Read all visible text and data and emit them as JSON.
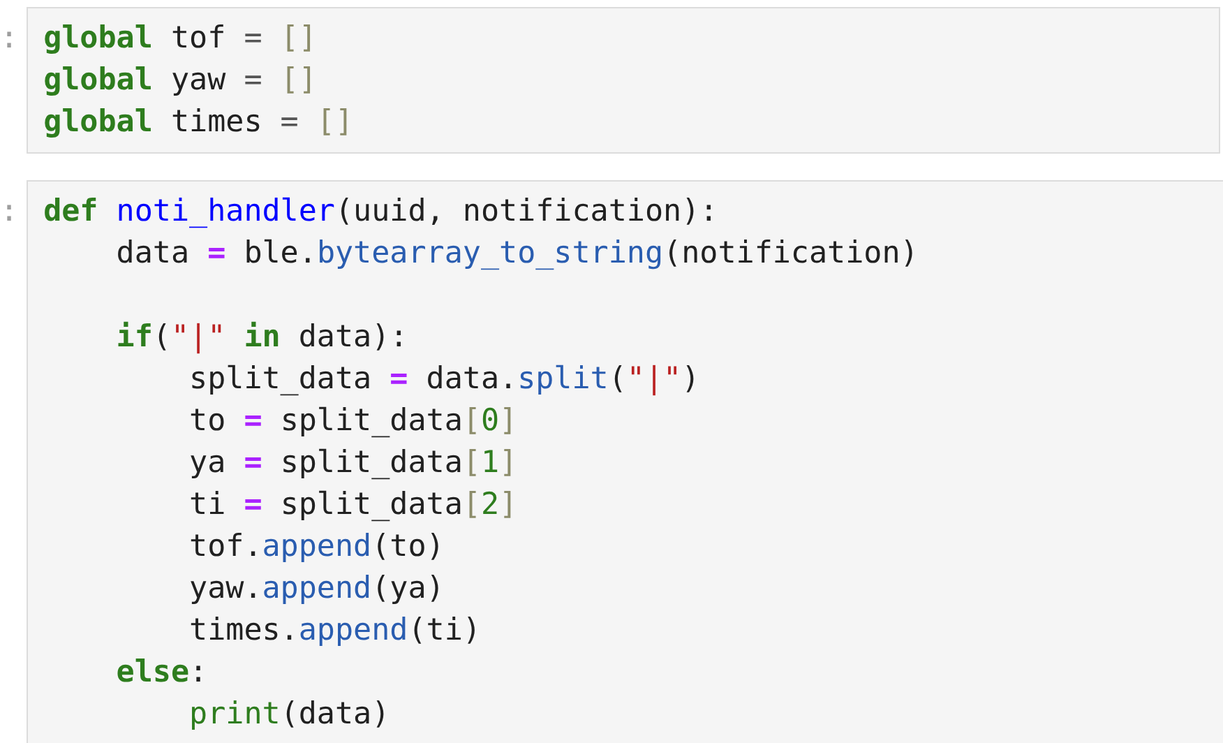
{
  "cells": [
    {
      "prompt": ":",
      "lines": [
        {
          "kind": "code",
          "tokens": [
            {
              "text": "global",
              "kind": "keyword"
            },
            {
              "text": " tof",
              "kind": "name"
            },
            {
              "text": " = ",
              "kind": "plain_op"
            },
            {
              "text": "[]",
              "kind": "bracket"
            }
          ]
        },
        {
          "kind": "code",
          "tokens": [
            {
              "text": "global",
              "kind": "keyword"
            },
            {
              "text": " yaw",
              "kind": "name"
            },
            {
              "text": " = ",
              "kind": "plain_op"
            },
            {
              "text": "[]",
              "kind": "bracket"
            }
          ]
        },
        {
          "kind": "code",
          "tokens": [
            {
              "text": "global",
              "kind": "keyword"
            },
            {
              "text": " times",
              "kind": "name"
            },
            {
              "text": " = ",
              "kind": "plain_op"
            },
            {
              "text": "[]",
              "kind": "bracket"
            }
          ]
        }
      ]
    },
    {
      "prompt": ":",
      "lines": [
        {
          "kind": "code",
          "tokens": [
            {
              "text": "def",
              "kind": "keyword"
            },
            {
              "text": " noti_handler",
              "kind": "function"
            },
            {
              "text": "(uuid, notification):",
              "kind": "name"
            }
          ]
        },
        {
          "kind": "code",
          "tokens": [
            {
              "text": "    data ",
              "kind": "name"
            },
            {
              "text": "=",
              "kind": "operator"
            },
            {
              "text": " ble.",
              "kind": "name"
            },
            {
              "text": "bytearray_to_string",
              "kind": "method"
            },
            {
              "text": "(notification)",
              "kind": "name"
            }
          ]
        },
        {
          "kind": "blank"
        },
        {
          "kind": "code",
          "tokens": [
            {
              "text": "    if",
              "kind": "keyword"
            },
            {
              "text": "(",
              "kind": "name"
            },
            {
              "text": "\"|\"",
              "kind": "string"
            },
            {
              "text": " in",
              "kind": "keyword"
            },
            {
              "text": " data):",
              "kind": "name"
            }
          ]
        },
        {
          "kind": "code",
          "tokens": [
            {
              "text": "        split_data ",
              "kind": "name"
            },
            {
              "text": "=",
              "kind": "operator"
            },
            {
              "text": " data.",
              "kind": "name"
            },
            {
              "text": "split",
              "kind": "method"
            },
            {
              "text": "(",
              "kind": "name"
            },
            {
              "text": "\"|\"",
              "kind": "string"
            },
            {
              "text": ")",
              "kind": "name"
            }
          ]
        },
        {
          "kind": "code",
          "tokens": [
            {
              "text": "        to ",
              "kind": "name"
            },
            {
              "text": "=",
              "kind": "operator"
            },
            {
              "text": " split_data",
              "kind": "name"
            },
            {
              "text": "[",
              "kind": "bracket"
            },
            {
              "text": "0",
              "kind": "number"
            },
            {
              "text": "]",
              "kind": "bracket"
            }
          ]
        },
        {
          "kind": "code",
          "tokens": [
            {
              "text": "        ya ",
              "kind": "name"
            },
            {
              "text": "=",
              "kind": "operator"
            },
            {
              "text": " split_data",
              "kind": "name"
            },
            {
              "text": "[",
              "kind": "bracket"
            },
            {
              "text": "1",
              "kind": "number"
            },
            {
              "text": "]",
              "kind": "bracket"
            }
          ]
        },
        {
          "kind": "code",
          "tokens": [
            {
              "text": "        ti ",
              "kind": "name"
            },
            {
              "text": "=",
              "kind": "operator"
            },
            {
              "text": " split_data",
              "kind": "name"
            },
            {
              "text": "[",
              "kind": "bracket"
            },
            {
              "text": "2",
              "kind": "number"
            },
            {
              "text": "]",
              "kind": "bracket"
            }
          ]
        },
        {
          "kind": "code",
          "tokens": [
            {
              "text": "        tof.",
              "kind": "name"
            },
            {
              "text": "append",
              "kind": "method"
            },
            {
              "text": "(to)",
              "kind": "name"
            }
          ]
        },
        {
          "kind": "code",
          "tokens": [
            {
              "text": "        yaw.",
              "kind": "name"
            },
            {
              "text": "append",
              "kind": "method"
            },
            {
              "text": "(ya)",
              "kind": "name"
            }
          ]
        },
        {
          "kind": "code",
          "tokens": [
            {
              "text": "        times.",
              "kind": "name"
            },
            {
              "text": "append",
              "kind": "method"
            },
            {
              "text": "(ti)",
              "kind": "name"
            }
          ]
        },
        {
          "kind": "code",
          "tokens": [
            {
              "text": "    else",
              "kind": "keyword"
            },
            {
              "text": ":",
              "kind": "name"
            }
          ]
        },
        {
          "kind": "code",
          "tokens": [
            {
              "text": "        print",
              "kind": "builtin"
            },
            {
              "text": "(data)",
              "kind": "name"
            }
          ]
        }
      ]
    }
  ]
}
